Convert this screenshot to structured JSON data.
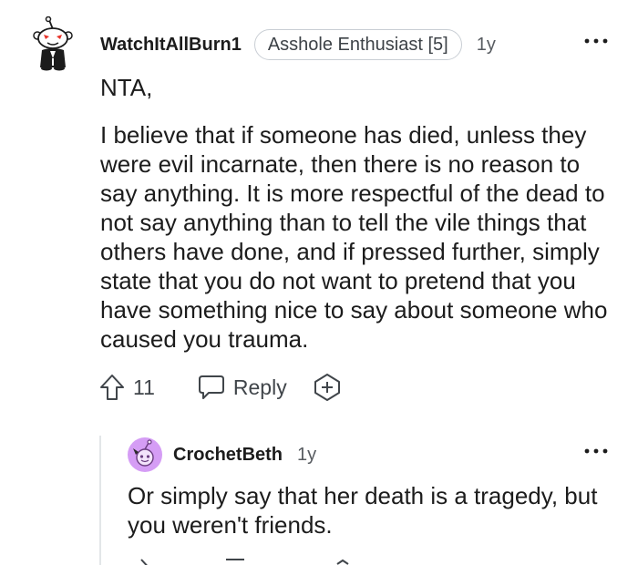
{
  "comment": {
    "username": "WatchItAllBurn1",
    "flair": "Asshole Enthusiast [5]",
    "age": "1y",
    "paragraphs": [
      "NTA,",
      "I believe that if someone has died, unless they were evil incarnate, then there is no reason to say anything. It is more respectful of the dead to not say anything than to tell the vile things that others have done, and if pressed further, simply state that you do not want to pretend that you have something nice to say about someone who caused you trauma."
    ],
    "actions": {
      "vote_count": "11",
      "reply_label": "Reply"
    }
  },
  "reply": {
    "username": "CrochetBeth",
    "age": "1y",
    "text": "Or simply say that her death is a tragedy, but you weren't friends."
  },
  "icons": {
    "upvote": "upvote-arrow-icon",
    "reply": "speech-bubble-icon",
    "award": "award-plus-icon",
    "more": "ellipsis-icon"
  },
  "colors": {
    "text": "#1c1c1c",
    "muted": "#575b60",
    "reply_avatar_bg": "#d59df5"
  }
}
